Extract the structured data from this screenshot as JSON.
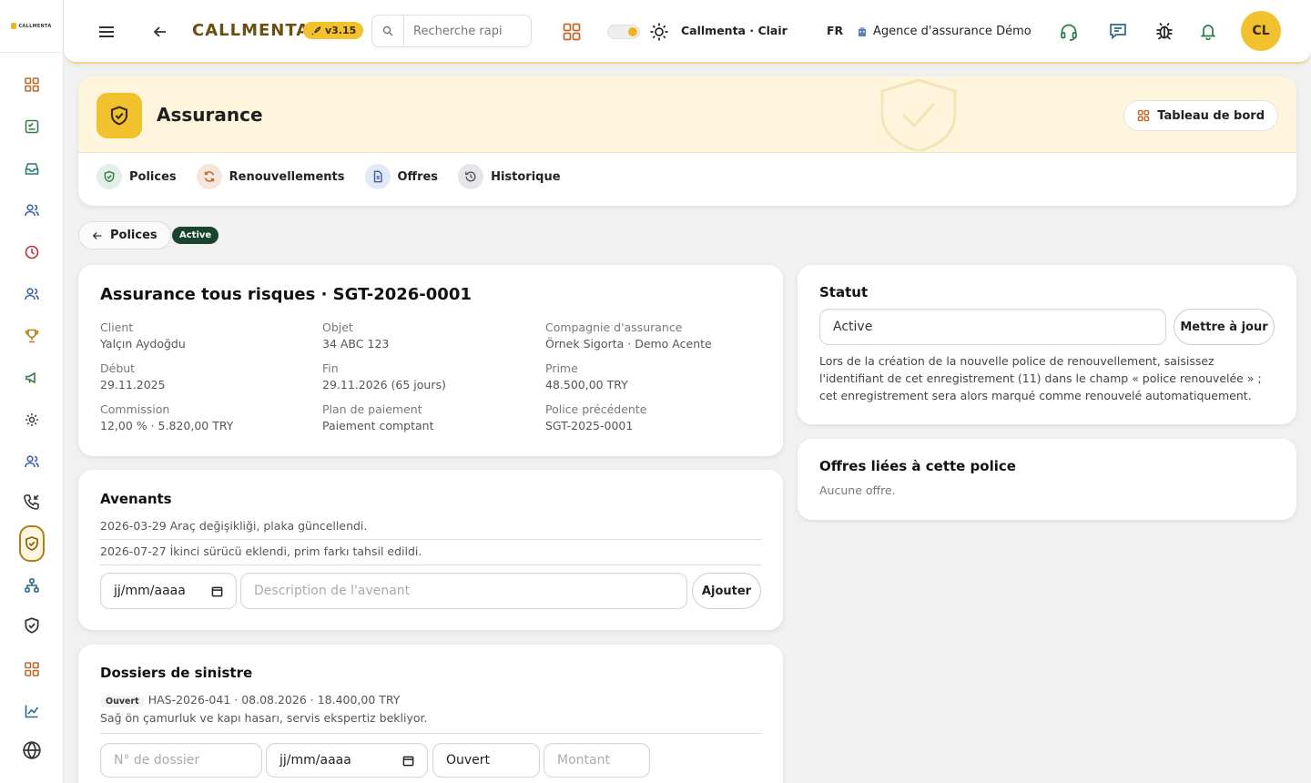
{
  "sidebar": {
    "logo": "CALLMENTA",
    "items": [
      "dashboard-icon",
      "tasks-icon",
      "inbox-icon",
      "contacts-icon",
      "clock-icon",
      "users-icon",
      "trophy-icon",
      "megaphone-icon",
      "gear-icon",
      "team-icon",
      "incoming-call-icon",
      "insurance-icon",
      "org-chart-icon",
      "shield-check-icon",
      "apps-icon",
      "analytics-icon",
      "globe-icon"
    ]
  },
  "topbar": {
    "brand": "CALLMENTA",
    "version": "v3.15",
    "search_placeholder": "Recherche rapi",
    "theme_label": "Callmenta · Clair",
    "language": "FR",
    "agency": "Agence d'assurance Démo",
    "avatar": "CL"
  },
  "header": {
    "title": "Assurance",
    "dashboard_button": "Tableau de bord",
    "tabs": [
      {
        "label": "Polices",
        "icon": "shield-icon"
      },
      {
        "label": "Renouvellements",
        "icon": "refresh-icon"
      },
      {
        "label": "Offres",
        "icon": "document-icon"
      },
      {
        "label": "Historique",
        "icon": "history-icon"
      }
    ]
  },
  "nav": {
    "back_label": "Polices",
    "status_badge": "Active"
  },
  "policy": {
    "title": "Assurance tous risques · SGT-2026-0001",
    "fields": [
      {
        "label": "Client",
        "value": "Yalçın Aydoğdu"
      },
      {
        "label": "Objet",
        "value": "34 ABC 123"
      },
      {
        "label": "Compagnie d'assurance",
        "value": "Örnek Sigorta · Demo Acente"
      },
      {
        "label": "Début",
        "value": "29.11.2025"
      },
      {
        "label": "Fin",
        "value": "29.11.2026 (65 jours)"
      },
      {
        "label": "Prime",
        "value": "48.500,00 TRY"
      },
      {
        "label": "Commission",
        "value": "12,00 % · 5.820,00 TRY"
      },
      {
        "label": "Plan de paiement",
        "value": "Paiement comptant"
      },
      {
        "label": "Police précédente",
        "value": "SGT-2025-0001"
      }
    ]
  },
  "endorsements": {
    "title": "Avenants",
    "items": [
      "2026-03-29 Araç değişikliği, plaka güncellendi.",
      "2026-07-27 İkinci sürücü eklendi, prim farkı tahsil edildi."
    ],
    "date_placeholder": "jj/mm/aaaa",
    "desc_placeholder": "Description de l'avenant",
    "add_button": "Ajouter"
  },
  "claims": {
    "title": "Dossiers de sinistre",
    "item_status": "Ouvert",
    "item_line": "HAS-2026-041 · 08.08.2026 · 18.400,00 TRY",
    "item_desc": "Sağ ön çamurluk ve kapı hasarı, servis ekspertiz bekliyor.",
    "number_placeholder": "N° de dossier",
    "date_placeholder": "jj/mm/aaaa",
    "status_value": "Ouvert",
    "amount_placeholder": "Montant"
  },
  "status_card": {
    "title": "Statut",
    "value": "Active",
    "update_button": "Mettre à jour",
    "help_text": "Lors de la création de la nouvelle police de renouvellement, saisissez l'identifiant de cet enregistrement (11) dans le champ « police renouvelée » ; cet enregistrement sera alors marqué comme renouvelé automatiquement."
  },
  "offers_card": {
    "title": "Offres liées à cette police",
    "empty": "Aucune offre."
  },
  "colors": {
    "accent": "#f2c12e",
    "badge": "#17432f",
    "brand": "#6b4f10"
  }
}
